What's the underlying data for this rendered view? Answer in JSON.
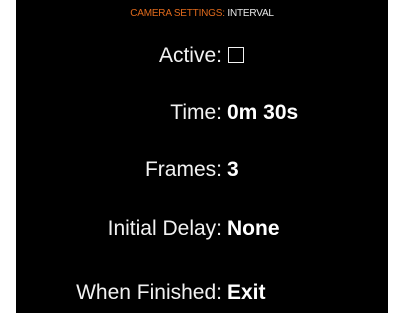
{
  "header": {
    "section": "CAMERA SETTINGS:",
    "subsection": " INTERVAL"
  },
  "settings": {
    "active": {
      "label": "Active:",
      "checked": false
    },
    "time": {
      "label": "Time:",
      "value": "0m 30s"
    },
    "frames": {
      "label": "Frames:",
      "value": "3"
    },
    "initial_delay": {
      "label": "Initial Delay:",
      "value": "None"
    },
    "when_finished": {
      "label": "When Finished:",
      "value": "Exit"
    }
  },
  "colors": {
    "background": "#000000",
    "header_accent": "#e06a1c",
    "text": "#ffffff"
  }
}
